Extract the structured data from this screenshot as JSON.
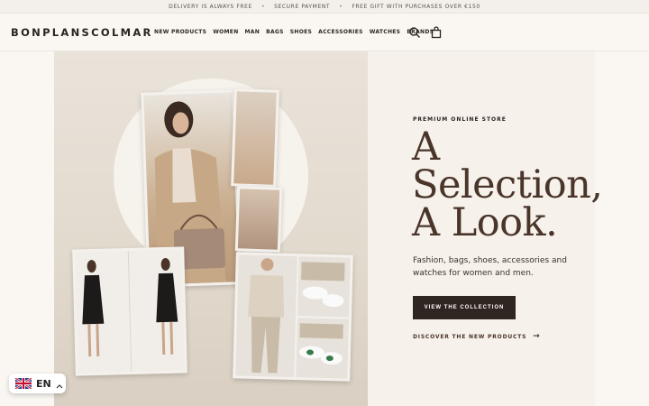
{
  "announcement": {
    "items": [
      "DELIVERY IS ALWAYS FREE",
      "SECURE PAYMENT",
      "FREE GIFT WITH PURCHASES OVER €150"
    ],
    "separator": "•"
  },
  "header": {
    "logo": "BONPLANSCOLMAR",
    "nav": [
      "NEW PRODUCTS",
      "WOMEN",
      "MAN",
      "BAGS",
      "SHOES",
      "ACCESSORIES",
      "WATCHES",
      "BRANDS"
    ],
    "icons": [
      "search-icon",
      "bag-icon"
    ]
  },
  "hero": {
    "eyebrow": "PREMIUM ONLINE STORE",
    "headline_line1": "A",
    "headline_line2": "Selection,",
    "headline_line3": "A Look.",
    "description": "Fashion, bags, shoes, accessories and watches for women and men.",
    "cta_label": "VIEW THE COLLECTION",
    "secondary_link": "DISCOVER THE NEW PRODUCTS",
    "arrow": "→"
  },
  "language": {
    "code": "EN",
    "flag": "gb-flag-icon",
    "chevron": "chevron-up-icon"
  },
  "colors": {
    "accent": "#4a352a",
    "button": "#2f2521",
    "panel": "#f6f1eb"
  }
}
